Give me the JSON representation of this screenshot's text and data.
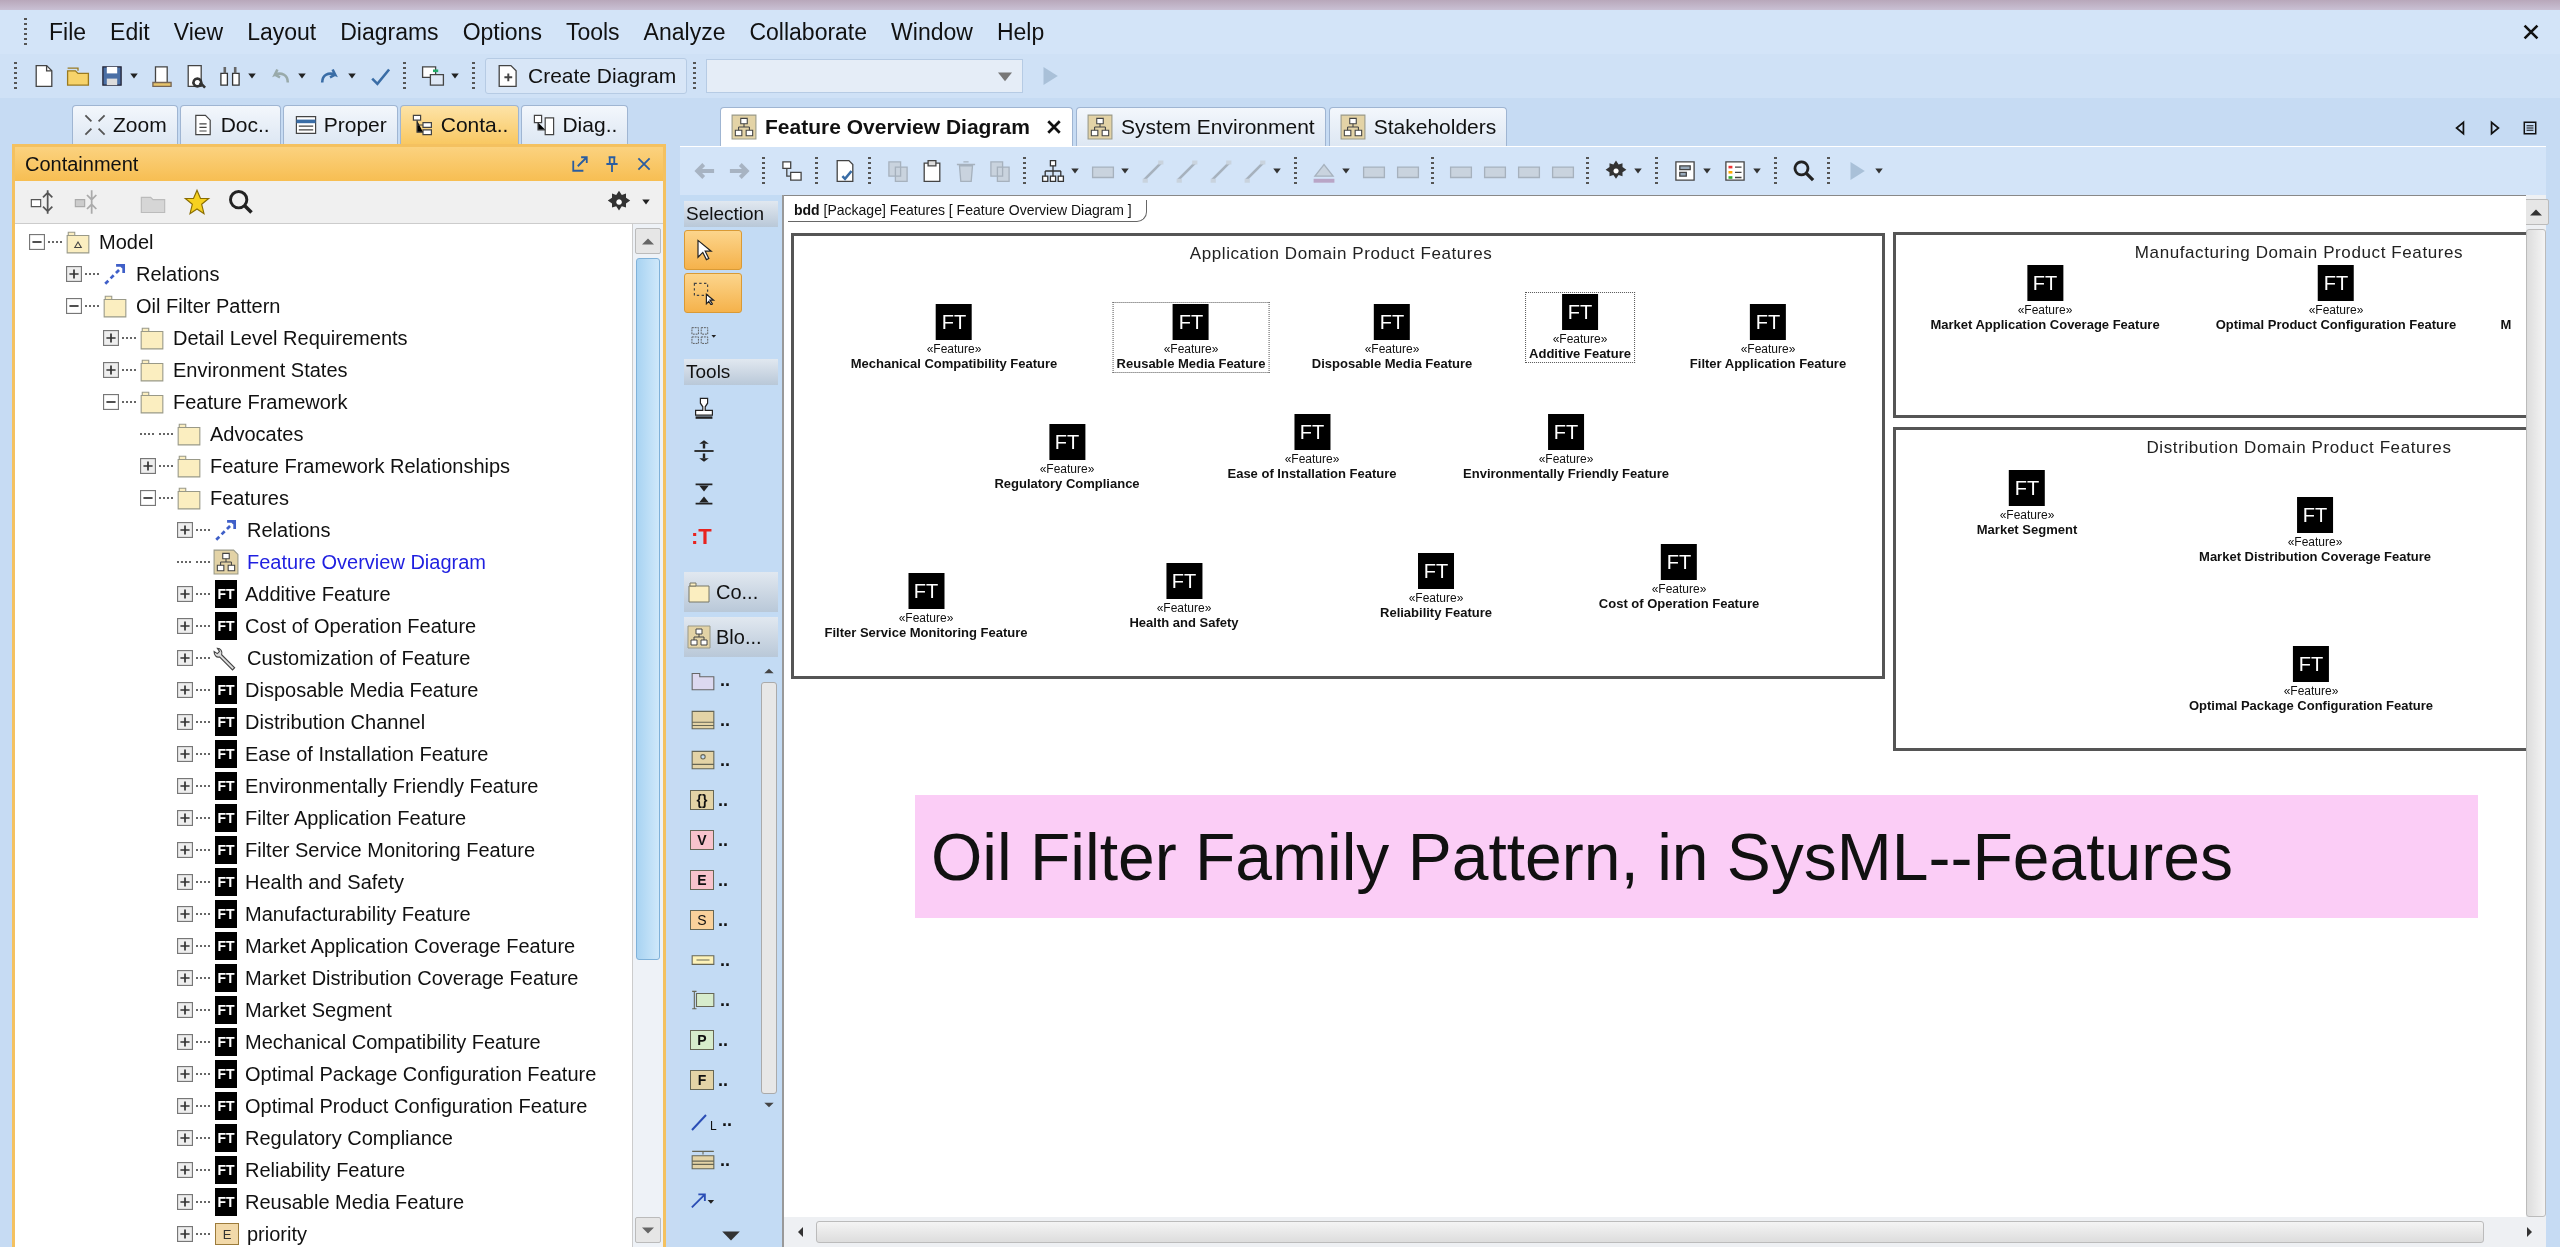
{
  "menu": [
    "File",
    "Edit",
    "View",
    "Layout",
    "Diagrams",
    "Options",
    "Tools",
    "Analyze",
    "Collaborate",
    "Window",
    "Help"
  ],
  "toolbar": {
    "create_button": "Create Diagram"
  },
  "left_tabs": [
    {
      "kind": "zoom",
      "label": "Zoom",
      "selected": false
    },
    {
      "kind": "doc",
      "label": "Doc..",
      "selected": false
    },
    {
      "kind": "props",
      "label": "Proper",
      "selected": false
    },
    {
      "kind": "tree",
      "label": "Conta..",
      "selected": true
    },
    {
      "kind": "diag",
      "label": "Diag..",
      "selected": false
    }
  ],
  "panel": {
    "title": "Containment"
  },
  "tree": [
    {
      "kind": "model",
      "label": "Model",
      "expanded": true,
      "children": [
        {
          "kind": "relation",
          "label": "Relations",
          "expanded": false
        },
        {
          "kind": "folder",
          "label": "Oil Filter Pattern",
          "expanded": true,
          "children": [
            {
              "kind": "folder",
              "label": "Detail Level Requirements",
              "expanded": false
            },
            {
              "kind": "folder",
              "label": "Environment States",
              "expanded": false
            },
            {
              "kind": "folder",
              "label": "Feature Framework",
              "expanded": true,
              "children": [
                {
                  "kind": "folder",
                  "label": "Advocates",
                  "leaf": true
                },
                {
                  "kind": "folder",
                  "label": "Feature Framework Relationships",
                  "expanded": false
                },
                {
                  "kind": "folder",
                  "label": "Features",
                  "expanded": true,
                  "children": [
                    {
                      "kind": "relation",
                      "label": "Relations",
                      "expanded": false
                    },
                    {
                      "kind": "diagram",
                      "label": "Feature Overview Diagram",
                      "leaf": true,
                      "link": true
                    },
                    {
                      "kind": "feature",
                      "badge": "FT",
                      "label": "Additive Feature",
                      "expanded": false
                    },
                    {
                      "kind": "feature",
                      "badge": "FT",
                      "label": "Cost of Operation Feature",
                      "expanded": false
                    },
                    {
                      "kind": "wrench",
                      "label": "Customization of Feature",
                      "expanded": false
                    },
                    {
                      "kind": "feature",
                      "badge": "FT",
                      "label": "Disposable Media Feature",
                      "expanded": false
                    },
                    {
                      "kind": "feature",
                      "badge": "FT",
                      "label": "Distribution Channel",
                      "expanded": false
                    },
                    {
                      "kind": "feature",
                      "badge": "FT",
                      "label": "Ease of Installation Feature",
                      "expanded": false
                    },
                    {
                      "kind": "feature",
                      "badge": "FT",
                      "label": "Environmentally Friendly Feature",
                      "expanded": false
                    },
                    {
                      "kind": "feature",
                      "badge": "FT",
                      "label": "Filter Application Feature",
                      "expanded": false
                    },
                    {
                      "kind": "feature",
                      "badge": "FT",
                      "label": "Filter Service Monitoring Feature",
                      "expanded": false
                    },
                    {
                      "kind": "feature",
                      "badge": "FT",
                      "label": "Health and Safety",
                      "expanded": false
                    },
                    {
                      "kind": "feature",
                      "badge": "FT",
                      "label": "Manufacturability Feature",
                      "expanded": false
                    },
                    {
                      "kind": "feature",
                      "badge": "FT",
                      "label": "Market Application Coverage Feature",
                      "expanded": false
                    },
                    {
                      "kind": "feature",
                      "badge": "FT",
                      "label": "Market Distribution Coverage Feature",
                      "expanded": false
                    },
                    {
                      "kind": "feature",
                      "badge": "FT",
                      "label": "Market Segment",
                      "expanded": false
                    },
                    {
                      "kind": "feature",
                      "badge": "FT",
                      "label": "Mechanical Compatibility Feature",
                      "expanded": false
                    },
                    {
                      "kind": "feature",
                      "badge": "FT",
                      "label": "Optimal Package Configuration Feature",
                      "expanded": false
                    },
                    {
                      "kind": "feature",
                      "badge": "FT",
                      "label": "Optimal Product Configuration Feature",
                      "expanded": false
                    },
                    {
                      "kind": "feature",
                      "badge": "FT",
                      "label": "Regulatory Compliance",
                      "expanded": false
                    },
                    {
                      "kind": "feature",
                      "badge": "FT",
                      "label": "Reliability Feature",
                      "expanded": false
                    },
                    {
                      "kind": "feature",
                      "badge": "FT",
                      "label": "Reusable Media Feature",
                      "expanded": false
                    },
                    {
                      "kind": "enum",
                      "badge": "E",
                      "label": "priority",
                      "expanded": false
                    }
                  ]
                }
              ]
            }
          ]
        }
      ]
    }
  ],
  "editor_tabs": [
    {
      "label": "Feature Overview Diagram",
      "selected": true
    },
    {
      "label": "System Environment",
      "selected": false
    },
    {
      "label": "Stakeholders",
      "selected": false
    }
  ],
  "palette": {
    "sections": [
      {
        "title": "Selection",
        "tools": [
          {
            "kind": "pointer",
            "selected": true
          },
          {
            "kind": "marquee",
            "selected": true
          },
          {
            "kind": "grid",
            "selected": false
          }
        ]
      },
      {
        "title": "Tools",
        "tools": [
          {
            "kind": "stamp",
            "selected": false
          },
          {
            "kind": "split",
            "selected": false
          },
          {
            "kind": "shrink",
            "selected": false
          },
          {
            "kind": "text",
            "glyph": ":T",
            "selected": false
          }
        ]
      }
    ],
    "groups": [
      {
        "kind": "folder",
        "title": "Co..."
      },
      {
        "kind": "diagram",
        "title": "Blo..."
      }
    ],
    "items": [
      {
        "kind": "package",
        "label": ".."
      },
      {
        "kind": "block",
        "label": ".."
      },
      {
        "kind": "iface",
        "label": ".."
      },
      {
        "kind": "constraint",
        "glyph": "{}",
        "label": ".."
      },
      {
        "kind": "value",
        "glyph": "V",
        "label": ".."
      },
      {
        "kind": "enum",
        "glyph": "E",
        "label": ".."
      },
      {
        "kind": "signal",
        "glyph": "S",
        "label": ".."
      },
      {
        "kind": "actor",
        "label": ".."
      },
      {
        "kind": "part",
        "label": ".."
      },
      {
        "kind": "port",
        "glyph": "P",
        "label": ".."
      },
      {
        "kind": "flow",
        "glyph": "F",
        "label": ".."
      },
      {
        "kind": "line",
        "glyph": "L",
        "label": ".."
      },
      {
        "kind": "instance",
        "label": ".."
      },
      {
        "kind": "arrow"
      }
    ]
  },
  "diagram": {
    "frame_label": "**bdd** [Package] Features [ Feature Overview  Diagram ]",
    "frames": [
      {
        "title": "Application Domain Product Features",
        "nodes": [
          {
            "badge": "FT",
            "stereotype": "«Feature»",
            "name": "Mechanical Compatibility Feature",
            "selected": false
          },
          {
            "badge": "FT",
            "stereotype": "«Feature»",
            "name": "Reusable Media Feature",
            "selected": true
          },
          {
            "badge": "FT",
            "stereotype": "«Feature»",
            "name": "Disposable Media Feature",
            "selected": false
          },
          {
            "badge": "FT",
            "stereotype": "«Feature»",
            "name": "Additive Feature",
            "selected": true
          },
          {
            "badge": "FT",
            "stereotype": "«Feature»",
            "name": "Filter Application Feature",
            "selected": false
          },
          {
            "badge": "FT",
            "stereotype": "«Feature»",
            "name": "Regulatory Compliance",
            "selected": false
          },
          {
            "badge": "FT",
            "stereotype": "«Feature»",
            "name": "Ease of Installation Feature",
            "selected": false
          },
          {
            "badge": "FT",
            "stereotype": "«Feature»",
            "name": "Environmentally Friendly Feature",
            "selected": false
          },
          {
            "badge": "FT",
            "stereotype": "«Feature»",
            "name": "Filter Service Monitoring Feature",
            "selected": false
          },
          {
            "badge": "FT",
            "stereotype": "«Feature»",
            "name": "Health and Safety",
            "selected": false
          },
          {
            "badge": "FT",
            "stereotype": "«Feature»",
            "name": "Reliability Feature",
            "selected": false
          },
          {
            "badge": "FT",
            "stereotype": "«Feature»",
            "name": "Cost of Operation Feature",
            "selected": false
          }
        ]
      },
      {
        "title": "Manufacturing Domain Product Features",
        "nodes": [
          {
            "badge": "FT",
            "stereotype": "«Feature»",
            "name": "Market Application Coverage Feature",
            "selected": false
          },
          {
            "badge": "FT",
            "stereotype": "«Feature»",
            "name": "Optimal Product Configuration Feature",
            "selected": false
          },
          {
            "name": "M",
            "selected": false
          }
        ]
      },
      {
        "title": "Distribution Domain Product Features",
        "nodes": [
          {
            "badge": "FT",
            "stereotype": "«Feature»",
            "name": "Market Segment",
            "selected": false
          },
          {
            "badge": "FT",
            "stereotype": "«Feature»",
            "name": "Market Distribution Coverage Feature",
            "selected": false
          },
          {
            "badge": "FT",
            "stereotype": "«Feature»",
            "name": "Optimal Package Configuration Feature",
            "selected": false
          }
        ]
      }
    ]
  },
  "caption": "Oil Filter Family Pattern, in SysML--Features"
}
